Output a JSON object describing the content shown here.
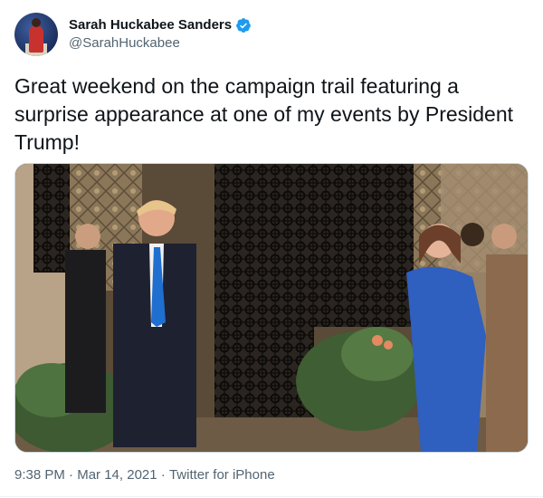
{
  "author": {
    "display_name": "Sarah Huckabee Sanders",
    "handle": "@SarahHuckabee",
    "verified": true,
    "verified_icon": "verified-badge-icon"
  },
  "tweet": {
    "text": "Great weekend on the campaign trail featuring a surprise appearance at one of my events by President Trump!"
  },
  "media": {
    "type": "photo"
  },
  "footer": {
    "time": "9:38 PM",
    "separator1": "·",
    "date": "Mar 14, 2021",
    "separator2": "·",
    "source": "Twitter for iPhone"
  },
  "colors": {
    "text_primary": "#0f1419",
    "text_secondary": "#536471",
    "verified_blue": "#1d9bf0",
    "border": "#cfd9de"
  }
}
